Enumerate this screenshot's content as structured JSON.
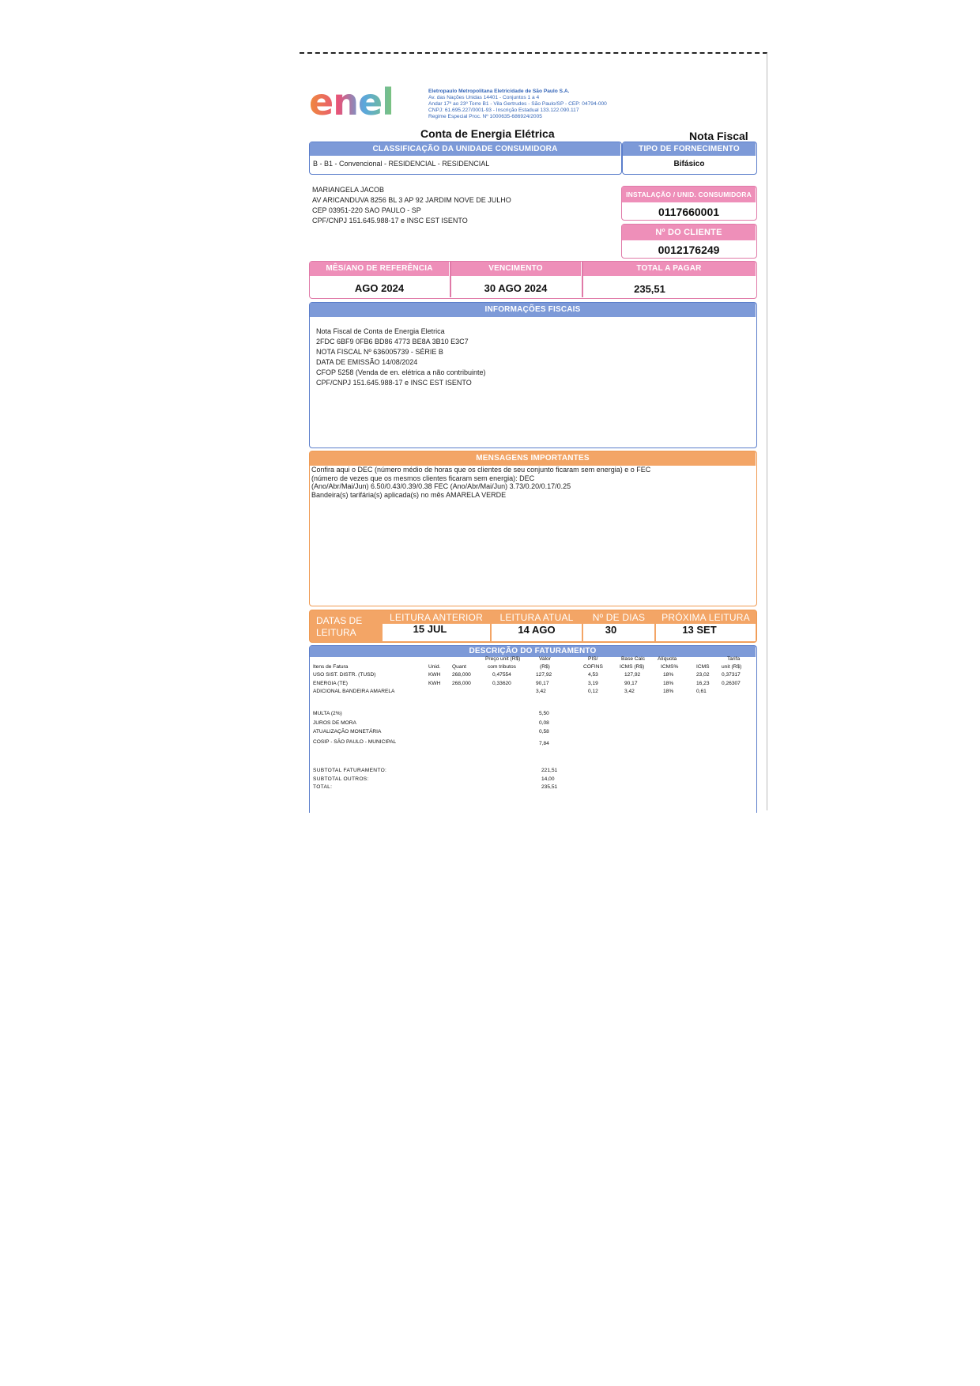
{
  "company": {
    "logo_text": "enel",
    "name": "Eletropaulo Metropolitana Eletricidade de São Paulo S.A.",
    "address_lines": [
      "Av. das Nações Unidas 14401 - Conjuntos 1 a 4",
      "Andar 17º ao 23º Torre B1 - Vila Gertrudes - São Paulo/SP - CEP: 04794-000",
      "CNPJ: 61.695.227/0001-93 - Inscrição Estadual 133.122.090.117",
      "Regime Especial Proc. Nº 1000635-686924/2005"
    ]
  },
  "document": {
    "title": "Conta de Energia Elétrica",
    "type": "Nota Fiscal"
  },
  "classification": {
    "header": "CLASSIFICAÇÃO DA UNIDADE CONSUMIDORA",
    "value": "B - B1 - Convencional - RESIDENCIAL - RESIDENCIAL"
  },
  "supply": {
    "header": "TIPO DE FORNECIMENTO",
    "value": "Bifásico"
  },
  "customer": {
    "lines": [
      "MARIANGELA JACOB",
      "AV ARICANDUVA 8256  BL 3 AP 92 JARDIM NOVE DE JULHO",
      "CEP  03951-220 SAO PAULO - SP",
      "CPF/CNPJ 151.645.988-17 e INSC EST ISENTO"
    ]
  },
  "installation": {
    "header": "INSTALAÇÃO / UNID. CONSUMIDORA",
    "value": "0117660001"
  },
  "client_number": {
    "header": "Nº DO CLIENTE",
    "value": "0012176249"
  },
  "billing_summary": {
    "ref_header": "MÊS/ANO DE REFERÊNCIA",
    "ref_value": "AGO 2024",
    "due_header": "VENCIMENTO",
    "due_value": "30 AGO 2024",
    "total_header": "TOTAL A PAGAR",
    "total_value": "235,51"
  },
  "fiscal_info": {
    "header": "INFORMAÇÕES FISCAIS",
    "lines": [
      "Nota Fiscal de Conta de Energia Eletrica",
      "2FDC 6BF9 0FB6 BD86 4773 BE8A 3B10 E3C7",
      "NOTA FISCAL  Nº 636005739 - SÉRIE B",
      "DATA DE EMISSÃO  14/08/2024",
      "CFOP  5258 (Venda de en. elétrica a não contribuinte)",
      "CPF/CNPJ 151.645.988-17 e INSC EST ISENTO"
    ]
  },
  "messages": {
    "header": "MENSAGENS IMPORTANTES",
    "lines": [
      "Confira aqui o DEC (número médio de horas que os clientes de seu conjunto ficaram sem energia) e o FEC",
      "(número de vezes que os mesmos clientes ficaram sem energia):  DEC",
      "(Ano/Abr/Mai/Jun) 6.50/0.43/0.39/0.38  FEC (Ano/Abr/Mai/Jun) 3.73/0.20/0.17/0.25",
      "Bandeira(s) tarifária(s) aplicada(s) no mês AMARELA VERDE"
    ]
  },
  "readings": {
    "label": "DATAS DE LEITURA",
    "prev_header": "LEITURA ANTERIOR",
    "prev_value": "15 JUL",
    "curr_header": "LEITURA ATUAL",
    "curr_value": "14 AGO",
    "days_header": "Nº DE DIAS",
    "days_value": "30",
    "next_header": "PRÓXIMA LEITURA",
    "next_value": "13 SET"
  },
  "billing_detail": {
    "header": "DESCRIÇÃO DO FATURAMENTO",
    "columns": {
      "items": "Itens de Fatura",
      "unit": "Unid.",
      "qty": "Quant",
      "price_top": "Preço unit (R$)",
      "price_bottom": "com tributos",
      "value_top": "Valor",
      "value_bottom": "(R$)",
      "pis_top": "PIS/",
      "pis_bottom": "COFINS",
      "base_top": "Base Calc",
      "base_bottom": "ICMS (R$)",
      "aliq_top": "Alíquota",
      "aliq_bottom": "ICMS%",
      "icms_top": "",
      "icms_bottom": "ICMS",
      "tarifa_top": "Tarifa",
      "tarifa_bottom": "unit (R$)"
    },
    "rows": [
      {
        "item": "USO SIST. DISTR. (TUSD)",
        "unit": "KWH",
        "qty": "268,000",
        "price": "0,47554",
        "value": "127,92",
        "pis": "4,53",
        "base": "127,92",
        "aliq": "18%",
        "icms": "23,02",
        "tarifa": "0,37317"
      },
      {
        "item": "ENERGIA (TE)",
        "unit": "KWH",
        "qty": "268,000",
        "price": "0,33620",
        "value": "90,17",
        "pis": "3,19",
        "base": "90,17",
        "aliq": "18%",
        "icms": "16,23",
        "tarifa": "0,26307"
      },
      {
        "item": "ADICIONAL BANDEIRA AMARELA",
        "unit": "",
        "qty": "",
        "price": "",
        "value": "3,42",
        "pis": "0,12",
        "base": "3,42",
        "aliq": "18%",
        "icms": "0,61",
        "tarifa": ""
      }
    ],
    "other_items": [
      {
        "item": "MULTA (2%)",
        "value": "5,50"
      },
      {
        "item": "JUROS DE MORA",
        "value": "0,08"
      },
      {
        "item": "ATUALIZAÇÃO MONETÁRIA",
        "value": "0,58"
      },
      {
        "item": "COSIP - SÃO PAULO - MUNICIPAL",
        "value": "7,84"
      }
    ],
    "totals": [
      {
        "label": "SUBTOTAL FATURAMENTO:",
        "value": "221,51"
      },
      {
        "label": "SUBTOTAL OUTROS:",
        "value": "14,00"
      },
      {
        "label": "TOTAL:",
        "value": "235,51"
      }
    ]
  }
}
